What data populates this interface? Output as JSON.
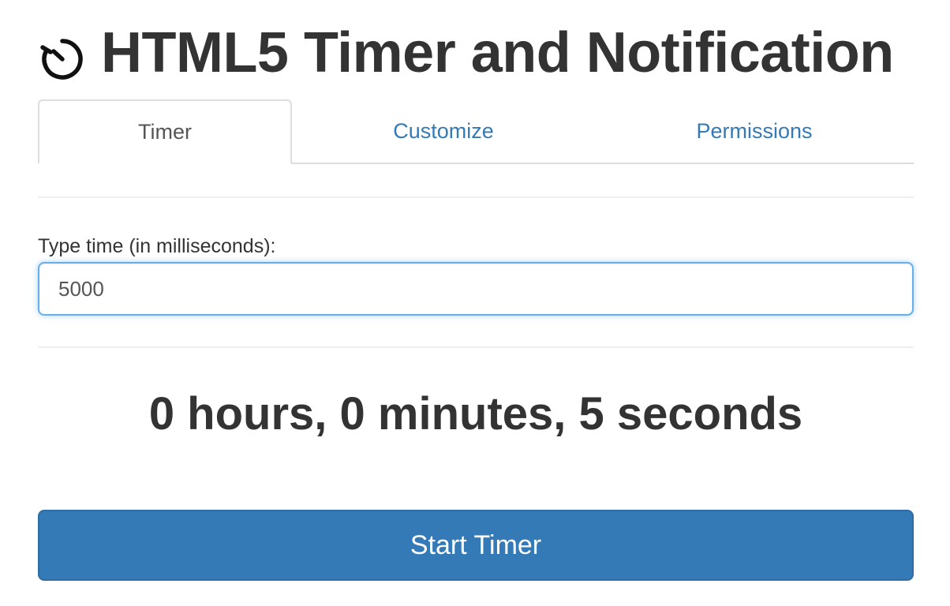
{
  "header": {
    "title": "HTML5 Timer and Notification",
    "icon": "stopwatch-icon"
  },
  "tabs": [
    {
      "label": "Timer",
      "active": true
    },
    {
      "label": "Customize",
      "active": false
    },
    {
      "label": "Permissions",
      "active": false
    }
  ],
  "form": {
    "label": "Type time (in milliseconds):",
    "value": "5000"
  },
  "readout": "0 hours, 0 minutes, 5 seconds",
  "button": {
    "label": "Start Timer"
  },
  "colors": {
    "accent": "#337ab7",
    "focus_border": "#66afe9",
    "text": "#333333"
  }
}
